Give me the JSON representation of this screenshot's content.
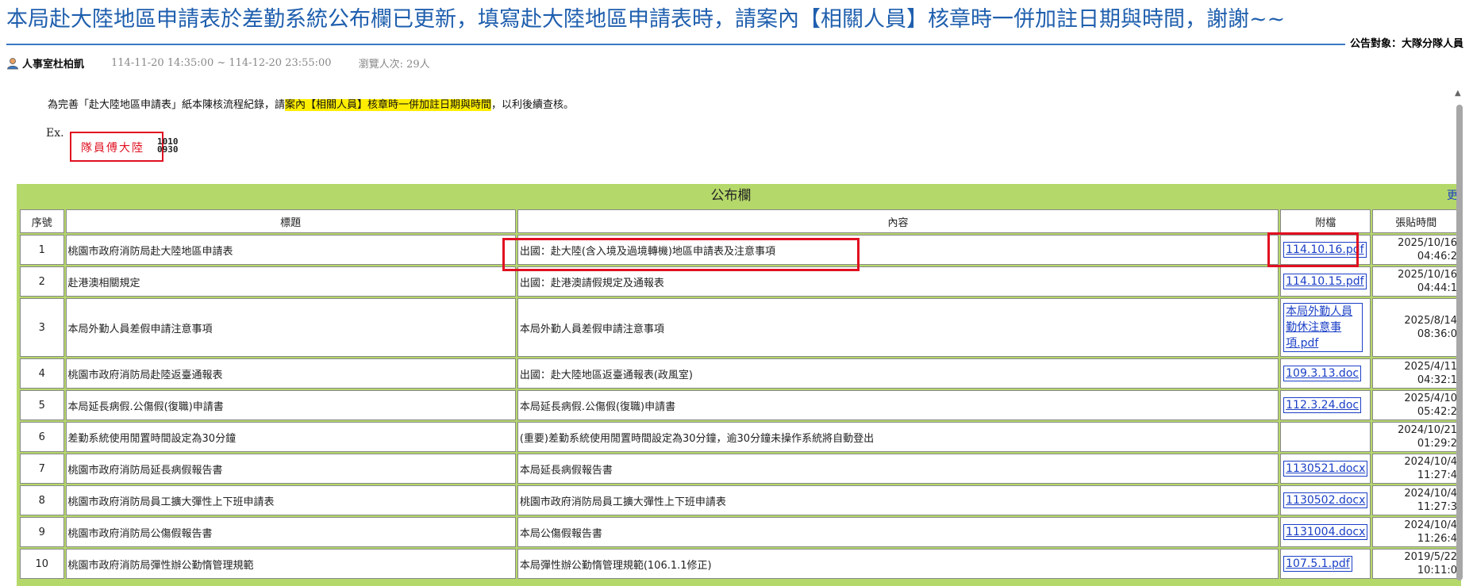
{
  "post": {
    "title": "本局赴大陸地區申請表於差勤系統公布欄已更新，填寫赴大陸地區申請表時，請案內【相關人員】核章時一併加註日期與時間，謝謝~~",
    "audience": "公告對象：大隊分隊人員",
    "author": "人事室杜柏凱",
    "dates": "114-11-20 14:35:00 ~ 114-12-20 23:55:00",
    "views": "瀏覽人次: 29人",
    "body_prefix": "為完善「赴大陸地區申請表」紙本陳核流程紀錄，請",
    "body_highlight": "案內【相關人員】核章時一併加註日期與時間",
    "body_suffix": "，以利後續查核。",
    "example_label": "Ex.",
    "example_stamp": "隊員傅大陸",
    "example_num_1": "1010",
    "example_num_2": "0930"
  },
  "board": {
    "title": "公布欄",
    "more_link": "更",
    "columns": [
      "序號",
      "標題",
      "內容",
      "附檔",
      "張貼時間"
    ],
    "rows": [
      {
        "no": "1",
        "title": "桃園市政府消防局赴大陸地區申請表",
        "content": "出國：赴大陸(含入境及過境轉機)地區申請表及注意事項",
        "attachment": "114.10.16.pdf",
        "date": "2025/10/16",
        "time": "04:46:2"
      },
      {
        "no": "2",
        "title": "赴港澳相關規定",
        "content": "出國：赴港澳請假規定及通報表",
        "attachment": "114.10.15.pdf",
        "date": "2025/10/16",
        "time": "04:44:1"
      },
      {
        "no": "3",
        "title": "本局外勤人員差假申請注意事項",
        "content": "本局外勤人員差假申請注意事項",
        "attachment": "本局外勤人員勤休注意事項.pdf",
        "date": "2025/8/14",
        "time": "08:36:0"
      },
      {
        "no": "4",
        "title": "桃園市政府消防局赴陸返臺通報表",
        "content": "出國：赴大陸地區返臺通報表(政風室)",
        "attachment": "109.3.13.doc",
        "date": "2025/4/11",
        "time": "04:32:1"
      },
      {
        "no": "5",
        "title": "本局延長病假.公傷假(復職)申請書",
        "content": "本局延長病假.公傷假(復職)申請書",
        "attachment": "112.3.24.doc",
        "date": "2025/4/10",
        "time": "05:42:2"
      },
      {
        "no": "6",
        "title": "差勤系統使用閒置時間設定為30分鐘",
        "content": "(重要)差勤系統使用閒置時間設定為30分鐘，逾30分鐘未操作系統將自動登出",
        "attachment": "",
        "date": "2024/10/21",
        "time": "01:29:2"
      },
      {
        "no": "7",
        "title": "桃園市政府消防局延長病假報告書",
        "content": "本局延長病假報告書",
        "attachment": "1130521.docx",
        "date": "2024/10/4",
        "time": "11:27:4"
      },
      {
        "no": "8",
        "title": "桃園市政府消防局員工擴大彈性上下班申請表",
        "content": "桃園市政府消防局員工擴大彈性上下班申請表",
        "attachment": "1130502.docx",
        "date": "2024/10/4",
        "time": "11:27:3"
      },
      {
        "no": "9",
        "title": "桃園市政府消防局公傷假報告書",
        "content": "本局公傷假報告書",
        "attachment": "1131004.docx",
        "date": "2024/10/4",
        "time": "11:26:4"
      },
      {
        "no": "10",
        "title": "桃園市政府消防局彈性辦公勤惰管理規範",
        "content": "本局彈性辦公勤惰管理規範(106.1.1修正)",
        "attachment": "107.5.1.pdf",
        "date": "2019/5/22",
        "time": "10:11:0"
      }
    ]
  },
  "colors": {
    "title": "#1f5fae",
    "board_bg": "#b5d86a",
    "highlight": "#ffee00",
    "annotation": "#e01020",
    "link": "#1a3fc6"
  }
}
